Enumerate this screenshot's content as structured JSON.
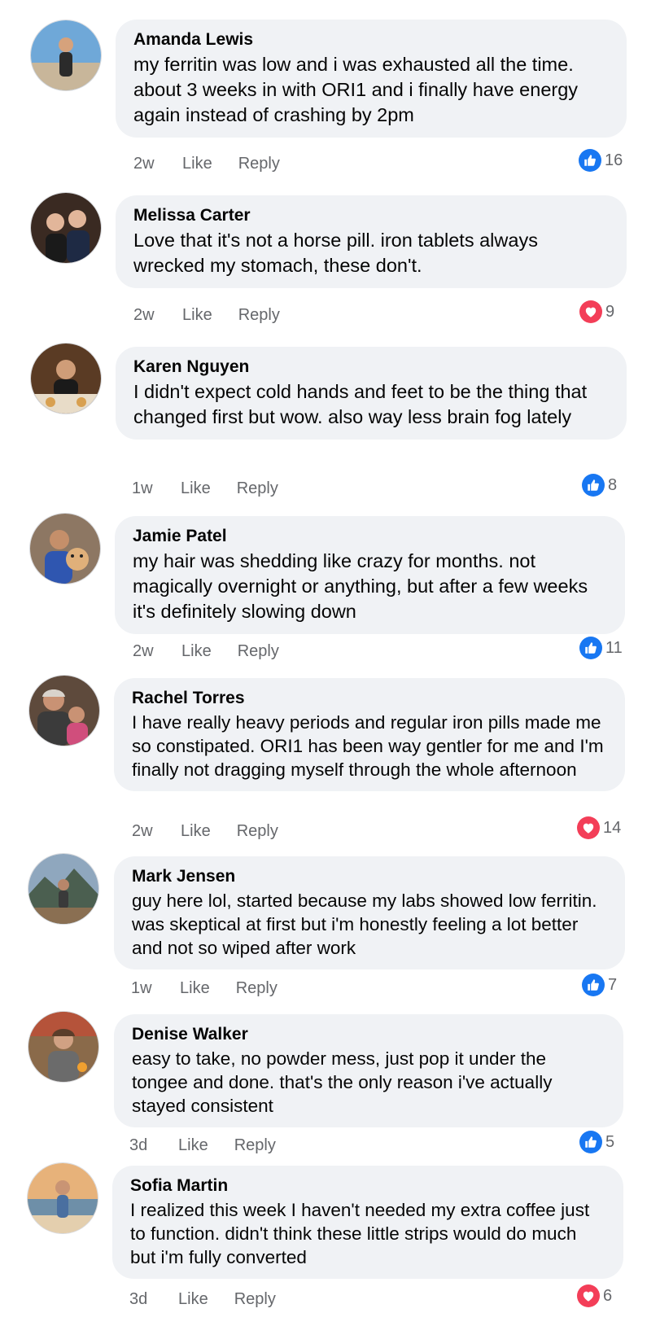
{
  "comments": [
    {
      "name": "Amanda Lewis",
      "text": "my ferritin was low and i was exhausted all the time. about 3 weeks in with ORI1 and i finally have energy again instead of crashing by 2pm",
      "time": "2w",
      "like": "Like",
      "reply": "Reply",
      "reaction": "like",
      "count": "16",
      "avatar": {
        "bg": "#6fa8d8",
        "fg": "#2b2b2b",
        "skin": "#d6a27c"
      }
    },
    {
      "name": "Melissa Carter",
      "text": "Love that it's not a horse pill. iron tablets always wrecked my stomach, these don't.",
      "time": "2w",
      "like": "Like",
      "reply": "Reply",
      "reaction": "love",
      "count": "9",
      "avatar": {
        "bg": "#3a2a22",
        "fg": "#1e2a44",
        "skin": "#e2b69a"
      }
    },
    {
      "name": "Karen Nguyen",
      "text": "I didn't expect cold hands and feet to be the thing that changed first but wow. also way less brain fog lately",
      "time": "1w",
      "like": "Like",
      "reply": "Reply",
      "reaction": "like",
      "count": "8",
      "avatar": {
        "bg": "#5a3b24",
        "fg": "#1a1a1a",
        "skin": "#cf9d78"
      }
    },
    {
      "name": "Jamie Patel",
      "text": "my hair was shedding like crazy for months. not magically overnight or anything, but after a few weeks it's definitely slowing down",
      "time": "2w",
      "like": "Like",
      "reply": "Reply",
      "reaction": "like",
      "count": "11",
      "avatar": {
        "bg": "#8d7763",
        "fg": "#2f56b0",
        "skin": "#c58f6a"
      }
    },
    {
      "name": "Rachel Torres",
      "text": "I have really heavy periods and regular iron pills made me so constipated. ORI1 has been way gentler for me and I'm finally not dragging myself through the whole afternoon",
      "time": "2w",
      "like": "Like",
      "reply": "Reply",
      "reaction": "love",
      "count": "14",
      "avatar": {
        "bg": "#5e4a3c",
        "fg": "#d04e7c",
        "skin": "#c99274"
      }
    },
    {
      "name": "Mark Jensen",
      "text": "guy here lol, started because my labs showed low ferritin. was skeptical at first but i'm honestly feeling a lot better and not so wiped after work",
      "time": "1w",
      "like": "Like",
      "reply": "Reply",
      "reaction": "like",
      "count": "7",
      "avatar": {
        "bg": "#8fa7be",
        "fg": "#3a3a3a",
        "skin": "#b8866a"
      }
    },
    {
      "name": "Denise Walker",
      "text": "easy to take, no powder mess, just pop it under the tongee and done. that's the only reason i've actually stayed consistent",
      "time": "3d",
      "like": "Like",
      "reply": "Reply",
      "reaction": "like",
      "count": "5",
      "avatar": {
        "bg": "#8a6a4a",
        "fg": "#6b6b6b",
        "skin": "#d1a183"
      }
    },
    {
      "name": "Sofia Martin",
      "text": "I realized this week I haven't needed my extra coffee just to function. didn't think these little strips would do much but i'm fully converted",
      "time": "3d",
      "like": "Like",
      "reply": "Reply",
      "reaction": "love",
      "count": "6",
      "avatar": {
        "bg": "#e7b27a",
        "fg": "#4a6fa0",
        "skin": "#c99474"
      }
    }
  ]
}
